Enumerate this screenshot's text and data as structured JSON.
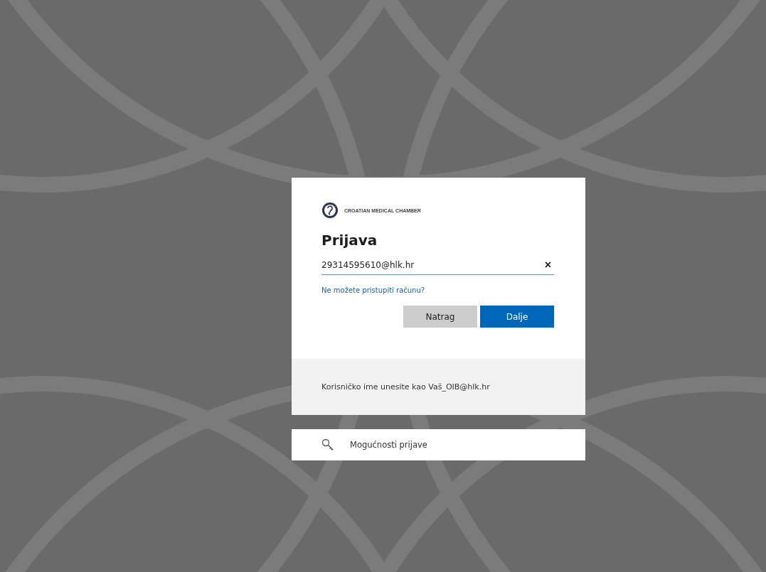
{
  "logo": {
    "text": "CROATIAN MEDICAL CHAMBER"
  },
  "title": "Prijava",
  "email_field": {
    "value": "29314595610@hlk.hr",
    "clear": "×"
  },
  "help_link": "Ne možete pristupiti računu?",
  "buttons": [
    {
      "label": "Natrag",
      "kind": "secondary"
    },
    {
      "label": "Dalje",
      "kind": "primary"
    }
  ],
  "hint": "Korisničko ime unesite kao Vaš_OIB@hlk.hr",
  "sign_in_options": "Mogućnosti prijave"
}
